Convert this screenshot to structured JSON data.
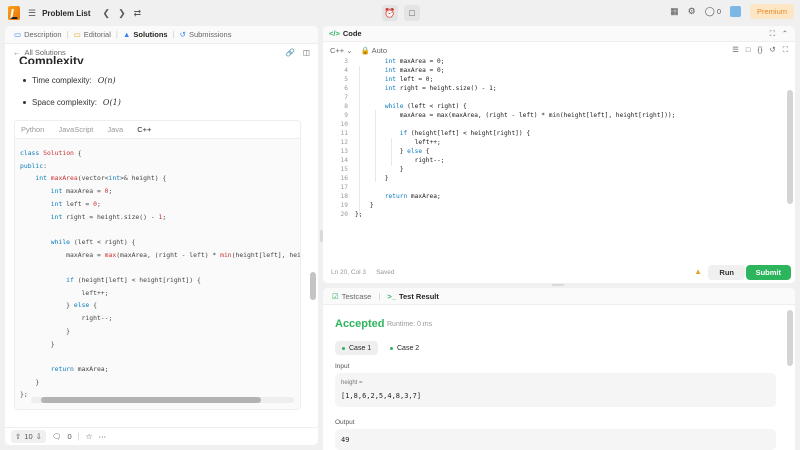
{
  "topbar": {
    "problem_list": "Problem List",
    "coins": "0",
    "premium": "Premium"
  },
  "left": {
    "tabs": [
      {
        "label": "Description"
      },
      {
        "label": "Editorial"
      },
      {
        "label": "Solutions"
      },
      {
        "label": "Submissions"
      }
    ],
    "back_label": "All Solutions",
    "heading": "Complexity",
    "time_complexity": "Time complexity:",
    "time_value": "O(n)",
    "space_complexity": "Space complexity:",
    "space_value": "O(1)",
    "lang_tabs": [
      "Python",
      "JavaScript",
      "Java",
      "C++"
    ],
    "upvotes": "10",
    "comments": "0"
  },
  "editor": {
    "title": "Code",
    "language": "C++",
    "mode": "Auto",
    "status_position": "Ln 20, Col 3",
    "status_saved": "Saved",
    "run": "Run",
    "submit": "Submit"
  },
  "result": {
    "tab_testcase": "Testcase",
    "tab_result": "Test Result",
    "verdict": "Accepted",
    "runtime": "Runtime: 0 ms",
    "case1": "Case 1",
    "case2": "Case 2",
    "input_label": "Input",
    "var_label": "height =",
    "input_value": "[1,8,6,2,5,4,8,3,7]",
    "output_label": "Output",
    "output_value": "49"
  },
  "colors": {
    "accent_green": "#2db55d",
    "brand_orange": "#ffa116",
    "premium_text": "#e7872a"
  }
}
